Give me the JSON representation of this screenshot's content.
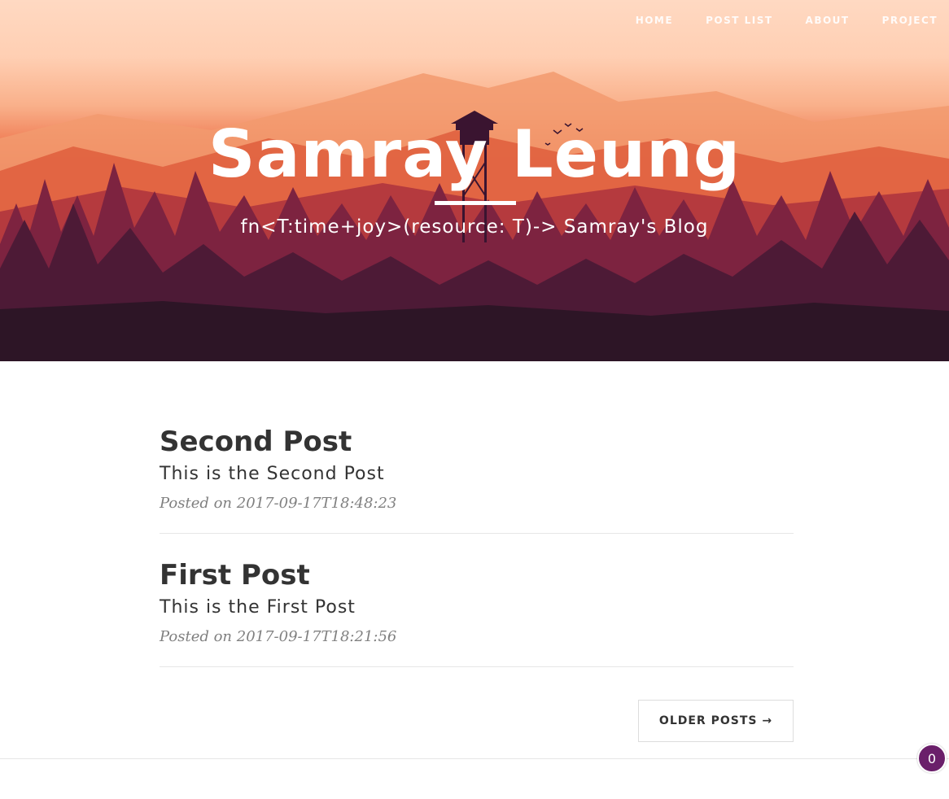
{
  "nav": {
    "items": [
      {
        "label": "HOME"
      },
      {
        "label": "POST LIST"
      },
      {
        "label": "ABOUT"
      },
      {
        "label": "PROJECT"
      }
    ]
  },
  "hero": {
    "title": "Samray Leung",
    "subtitle": "fn<T:time+joy>(resource: T)-> Samray's Blog"
  },
  "posts": [
    {
      "title": "Second Post",
      "subtitle": "This is the Second Post",
      "meta": "Posted on 2017-09-17T18:48:23"
    },
    {
      "title": "First Post",
      "subtitle": "This is the First Post",
      "meta": "Posted on 2017-09-17T18:21:56"
    }
  ],
  "pager": {
    "older_label": "OLDER POSTS →"
  },
  "badge": {
    "count": "0"
  },
  "colors": {
    "badge": "#6a1f6a",
    "text": "#333333",
    "meta": "#808080"
  }
}
